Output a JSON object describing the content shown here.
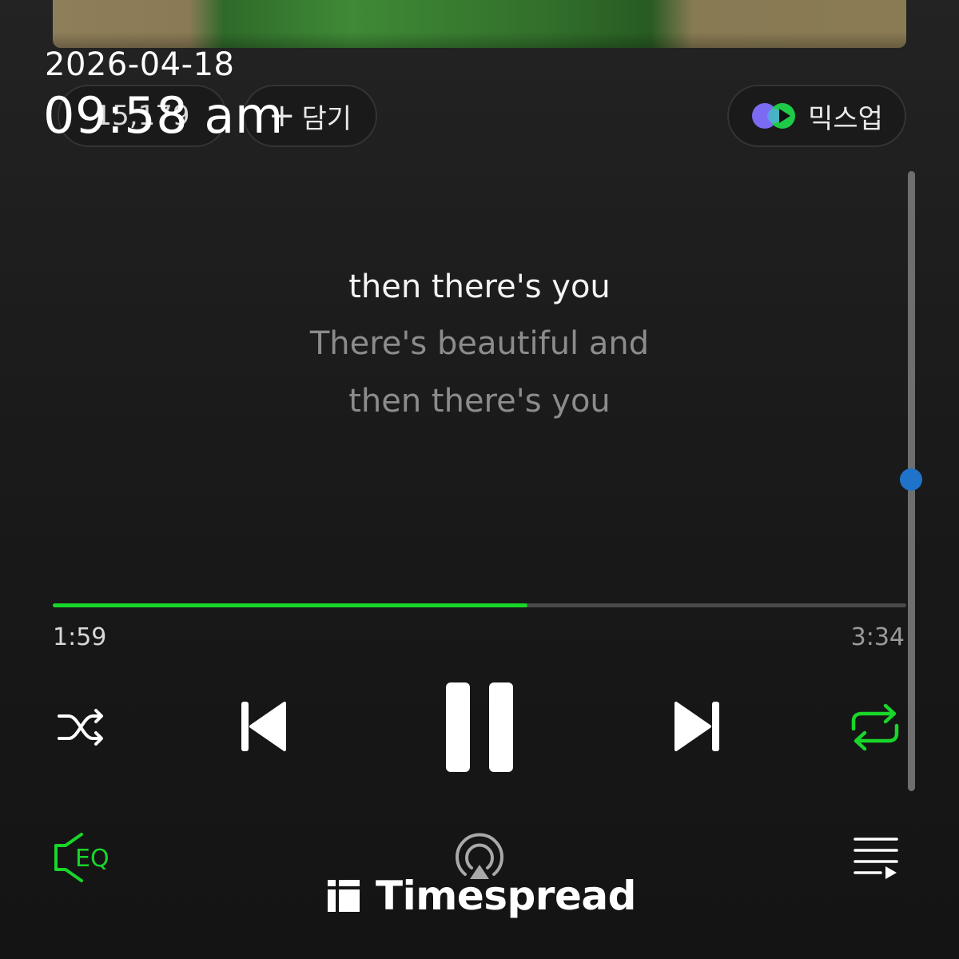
{
  "timestamp": {
    "date": "2026-04-18",
    "time": "09:58 am"
  },
  "header": {
    "likes_count": "15,179",
    "add_label": "담기",
    "add_plus": "+",
    "mixup_label": "믹스업"
  },
  "lyrics": {
    "current": "then there's you",
    "next": "There's beautiful and",
    "next2": "then there's you"
  },
  "player": {
    "elapsed": "1:59",
    "total": "3:34",
    "progress_fraction": 0.556,
    "repeat_active": true,
    "accent_color": "#19d62a"
  },
  "controls": {
    "shuffle_icon": "shuffle-icon",
    "prev_icon": "skip-previous-icon",
    "pause_icon": "pause-icon",
    "next_icon": "skip-next-icon",
    "repeat_icon": "repeat-icon",
    "eq_label": "EQ",
    "cast_icon": "airplay-icon",
    "queue_icon": "playlist-icon"
  },
  "watermark": {
    "text": "Timespread"
  }
}
